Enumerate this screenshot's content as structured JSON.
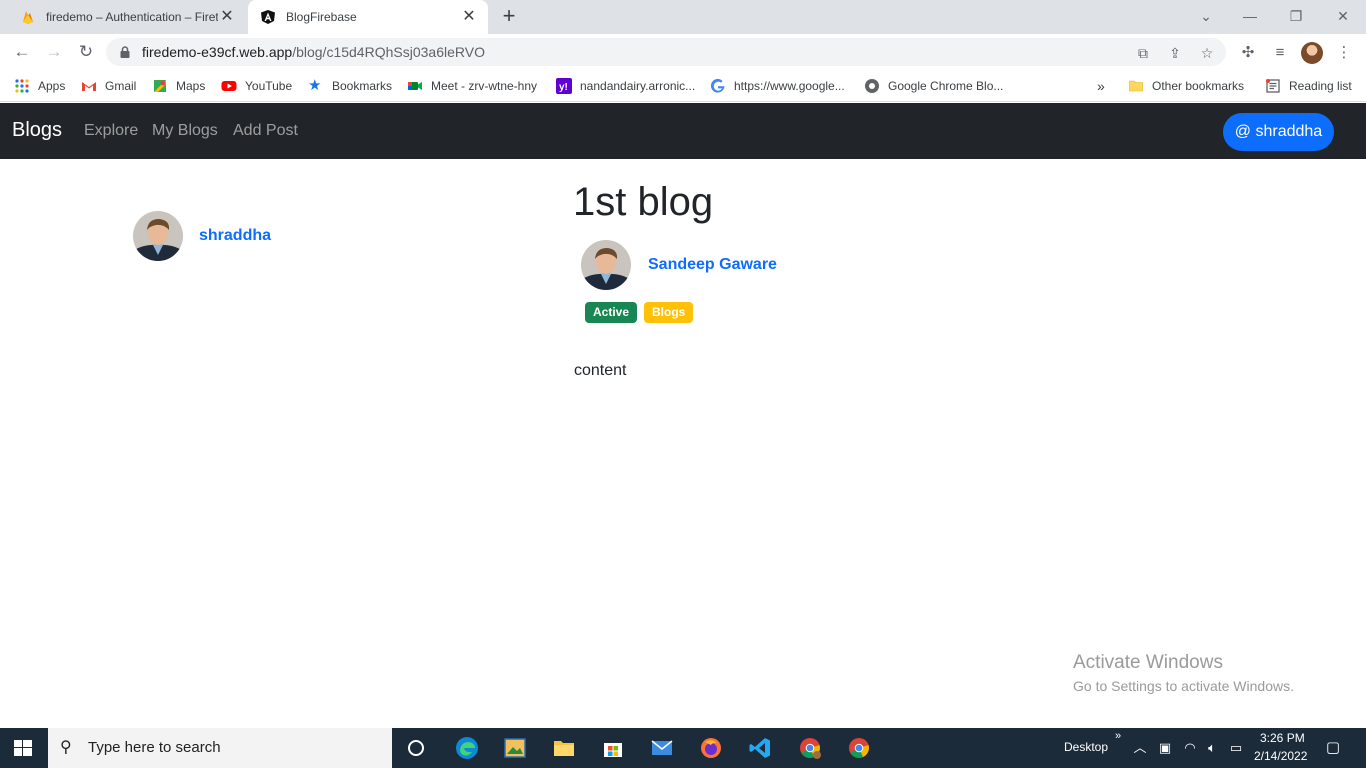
{
  "browser": {
    "tabs": [
      {
        "title": "firedemo – Authentication – Firet",
        "active": false
      },
      {
        "title": "BlogFirebase",
        "active": true
      }
    ],
    "url_host": "firedemo-e39cf.web.app",
    "url_path": "/blog/c15d4RQhSsj03a6leRVO",
    "bookmarks": [
      {
        "label": "Apps"
      },
      {
        "label": "Gmail"
      },
      {
        "label": "Maps"
      },
      {
        "label": "YouTube"
      },
      {
        "label": "Bookmarks"
      },
      {
        "label": "Meet - zrv-wtne-hny"
      },
      {
        "label": "nandandairy.arronic..."
      },
      {
        "label": "https://www.google..."
      },
      {
        "label": "Google Chrome Blo..."
      }
    ],
    "more_bookmarks": "»",
    "other_bookmarks": "Other bookmarks",
    "reading_list": "Reading list"
  },
  "app": {
    "brand": "Blogs",
    "nav": [
      "Explore",
      "My Blogs",
      "Add Post"
    ],
    "user_button": "@ shraddha"
  },
  "sidebar": {
    "username": "shraddha"
  },
  "post": {
    "title": "1st blog",
    "author": "Sandeep Gaware",
    "badges": [
      "Active",
      "Blogs"
    ],
    "content": "content"
  },
  "watermark": {
    "line1": "Activate Windows",
    "line2": "Go to Settings to activate Windows."
  },
  "taskbar": {
    "search_placeholder": "Type here to search",
    "desktop_label": "Desktop",
    "time": "3:26 PM",
    "date": "2/14/2022"
  },
  "colors": {
    "navbar": "#212529",
    "primary": "#0d6efd",
    "badge_active": "#198754",
    "badge_blogs": "#ffc107"
  }
}
